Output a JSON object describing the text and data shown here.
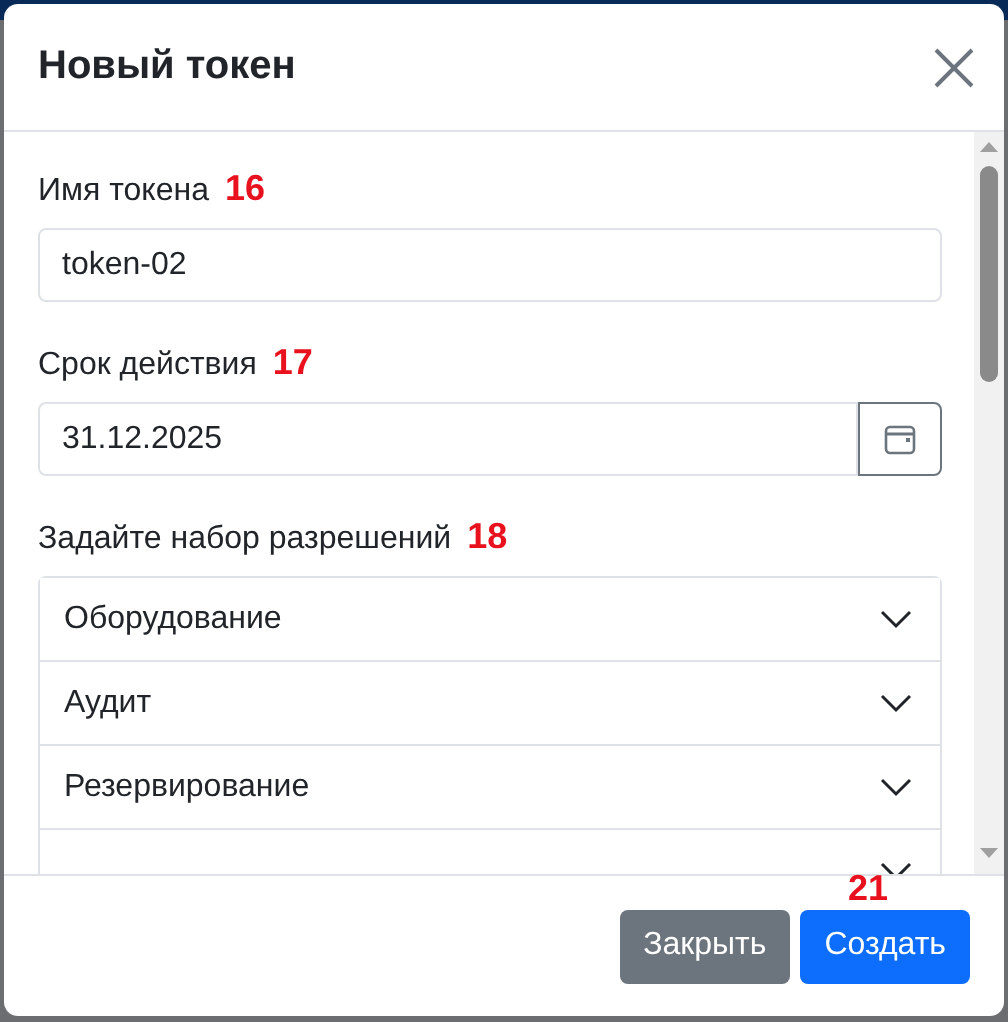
{
  "dialog": {
    "title": "Новый токен"
  },
  "fields": [
    {
      "kind": "text",
      "label": "Имя токена",
      "marker": "16",
      "value": "token-02"
    },
    {
      "kind": "date",
      "label": "Срок действия",
      "marker": "17",
      "value": "31.12.2025"
    }
  ],
  "permissions": {
    "label": "Задайте набор разрешений",
    "marker": "18",
    "items": [
      {
        "title": "Оборудование",
        "expanded": false
      },
      {
        "title": "Аудит",
        "expanded": false
      },
      {
        "title": "Резервирование",
        "expanded": false
      },
      {
        "expanded": false
      }
    ]
  },
  "footer": {
    "marker": "21",
    "buttons": [
      {
        "label": "Закрыть",
        "kind": "secondary"
      },
      {
        "label": "Создать",
        "kind": "primary"
      }
    ]
  }
}
